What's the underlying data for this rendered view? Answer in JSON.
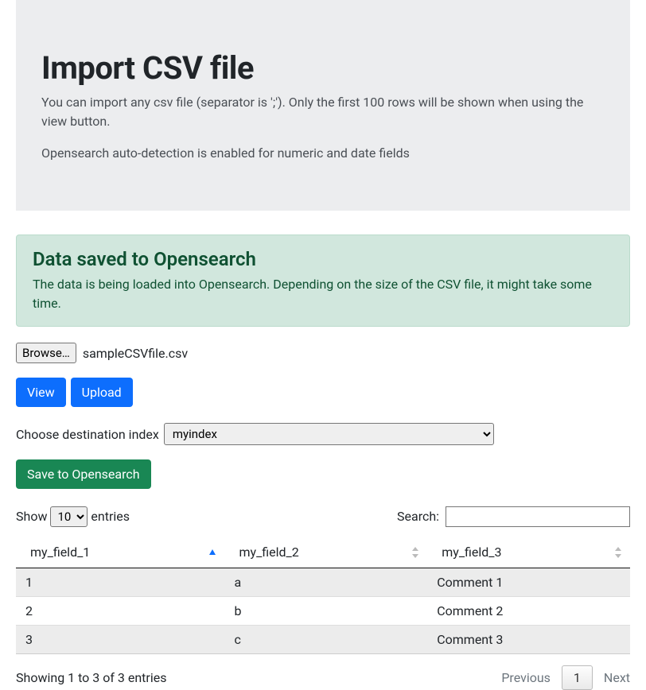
{
  "header": {
    "title": "Import CSV file",
    "desc1": "You can import any csv file (separator is ';'). Only the first 100 rows will be shown when using the view button.",
    "desc2": "Opensearch auto-detection is enabled for numeric and date fields"
  },
  "alert": {
    "title": "Data saved to Opensearch",
    "body": "The data is being loaded into Opensearch. Depending on the size of the CSV file, it might take some time."
  },
  "file": {
    "browse_label": "Browse…",
    "filename": "sampleCSVfile.csv"
  },
  "buttons": {
    "view": "View",
    "upload": "Upload",
    "save": "Save to Opensearch"
  },
  "destination": {
    "label": "Choose destination index",
    "selected": "myindex"
  },
  "table_controls": {
    "show_prefix": "Show ",
    "show_suffix": " entries",
    "length_value": "10",
    "search_label": "Search:"
  },
  "table": {
    "columns": [
      "my_field_1",
      "my_field_2",
      "my_field_3"
    ],
    "rows": [
      {
        "c0": "1",
        "c1": "a",
        "c2": "Comment 1"
      },
      {
        "c0": "2",
        "c1": "b",
        "c2": "Comment 2"
      },
      {
        "c0": "3",
        "c1": "c",
        "c2": "Comment 3"
      }
    ]
  },
  "footer": {
    "info": "Showing 1 to 3 of 3 entries",
    "previous": "Previous",
    "page": "1",
    "next": "Next"
  }
}
